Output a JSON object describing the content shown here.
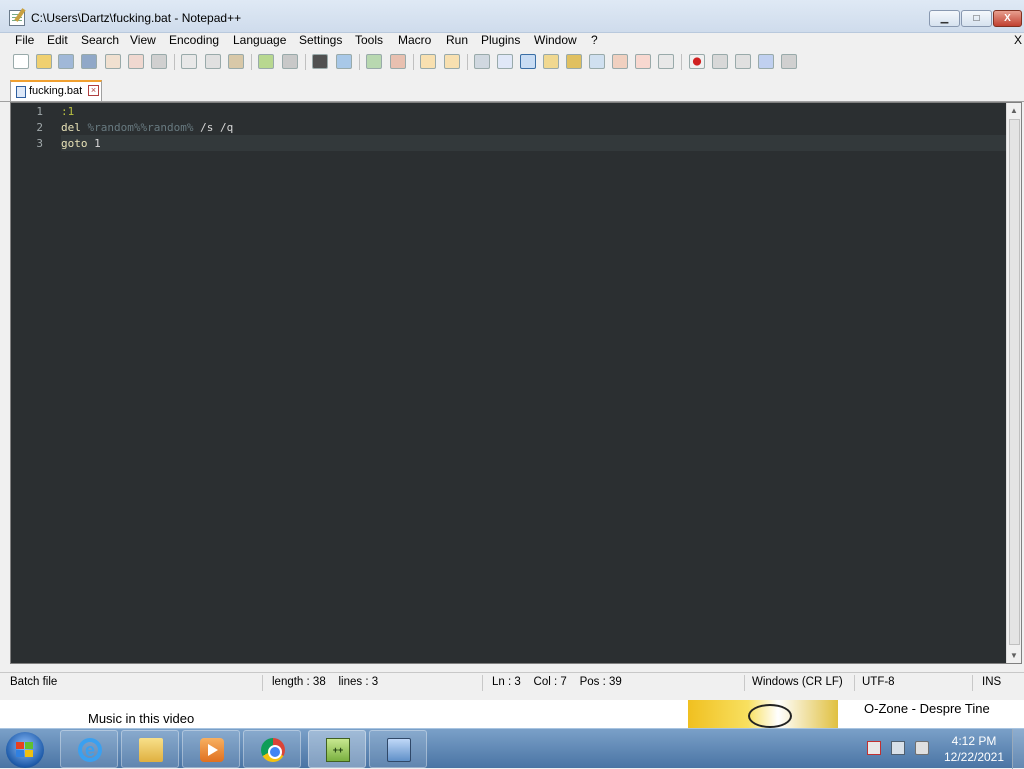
{
  "window": {
    "title": "C:\\Users\\Dartz\\fucking.bat - Notepad++",
    "min_label": "▁",
    "max_label": "□",
    "close_label": "X"
  },
  "menu": [
    "File",
    "Edit",
    "Search",
    "View",
    "Encoding",
    "Language",
    "Settings",
    "Tools",
    "Macro",
    "Run",
    "Plugins",
    "Window",
    "?"
  ],
  "menu_close": "X",
  "toolbar": {
    "icons": [
      "new-file-icon",
      "open-file-icon",
      "save-icon",
      "save-all-icon",
      "close-icon",
      "close-all-icon",
      "print-icon",
      "cut-icon",
      "copy-icon",
      "paste-icon",
      "undo-icon",
      "redo-icon",
      "find-icon",
      "replace-icon",
      "zoom-in-icon",
      "zoom-out-icon",
      "sync-vertical-icon",
      "sync-horizontal-icon",
      "word-wrap-icon",
      "show-all-characters-icon",
      "indent-guide-icon",
      "user-defined-language-icon",
      "doc-map-icon",
      "function-list-icon",
      "folder-as-workspace-icon",
      "monitoring-icon",
      "start-recording-icon",
      "stop-recording-icon",
      "playback-icon",
      "run-macro-multiple-icon",
      "save-macro-icon"
    ]
  },
  "tab": {
    "label": "fucking.bat",
    "close_label": "×"
  },
  "editor": {
    "line_numbers": [
      "1",
      "2",
      "3"
    ],
    "lines": [
      {
        "label": ":1"
      },
      {
        "cmd": "del ",
        "var": "%random%%random%",
        "rest": " /s /q"
      },
      {
        "cmd": "goto",
        "rest": " 1"
      }
    ],
    "theme": {
      "background": "#2b2f31",
      "label": "#b8c040",
      "keyword": "#e8e2b7",
      "variable": "#687a80"
    }
  },
  "status": {
    "file_type": "Batch file",
    "length": "length : 38    lines : 3",
    "position": "Ln : 3    Col : 7    Pos : 39",
    "eol": "Windows (CR LF)",
    "encoding": "UTF-8",
    "mode": "INS"
  },
  "overlay": {
    "music_label": "Music in this video",
    "song_title": "O-Zone - Despre Tine"
  },
  "taskbar": {
    "apps": [
      "internet-explorer-icon",
      "file-explorer-icon",
      "media-player-icon",
      "chrome-icon",
      "notepad-plus-plus-icon",
      "remote-desktop-icon"
    ],
    "active_app": "notepad-plus-plus-icon",
    "time": "4:12 PM",
    "date": "12/22/2021"
  }
}
